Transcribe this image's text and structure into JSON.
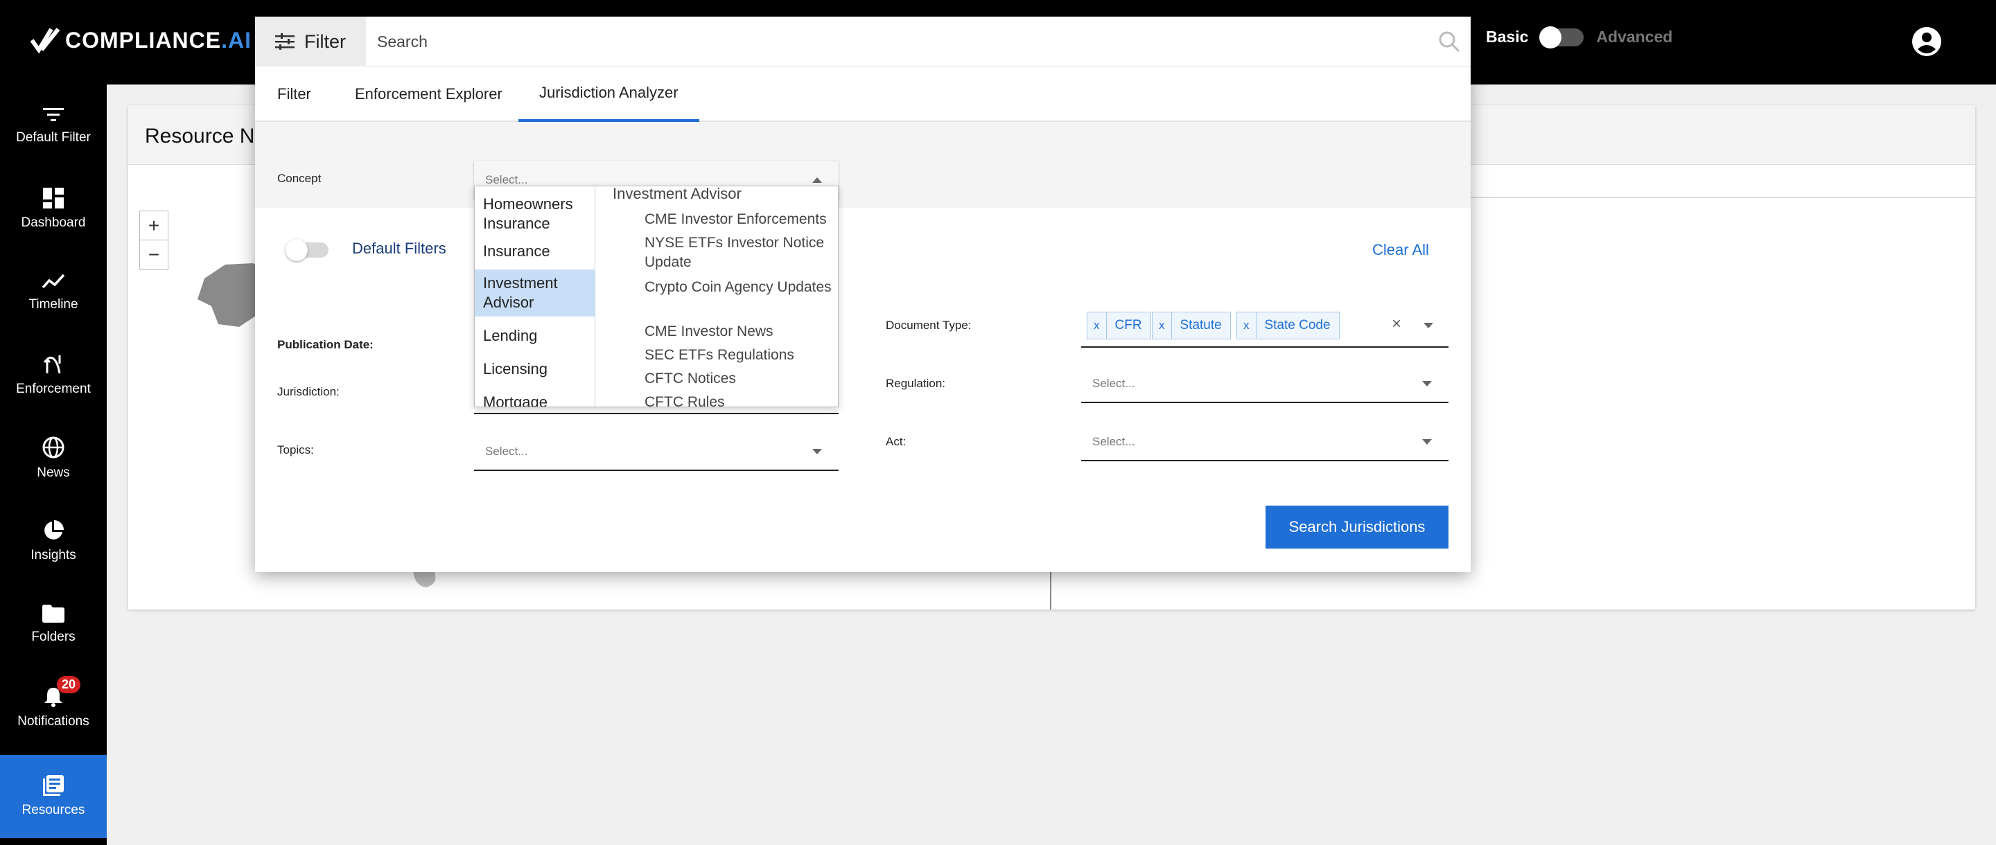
{
  "brand": {
    "name_main": "COMPLIANCE",
    "name_suffix": ".AI"
  },
  "header": {
    "mode_basic": "Basic",
    "mode_advanced": "Advanced"
  },
  "sidebar": {
    "items": [
      {
        "label": "Default Filter",
        "icon": "filter-lines-icon"
      },
      {
        "label": "Dashboard",
        "icon": "dashboard-icon"
      },
      {
        "label": "Timeline",
        "icon": "timeline-icon"
      },
      {
        "label": "Enforcement",
        "icon": "enforcement-icon"
      },
      {
        "label": "News",
        "icon": "globe-icon"
      },
      {
        "label": "Insights",
        "icon": "pie-chart-icon"
      },
      {
        "label": "Folders",
        "icon": "folder-icon"
      },
      {
        "label": "Notifications",
        "icon": "bell-icon",
        "badge": "20"
      },
      {
        "label": "Resources",
        "icon": "resources-icon",
        "active": true
      }
    ]
  },
  "background": {
    "card_title": "Resource Nav",
    "zoom_in": "+",
    "zoom_out": "−"
  },
  "modal": {
    "filter_button": "Filter",
    "search_placeholder": "Search",
    "tabs": [
      "Filter",
      "Enforcement Explorer",
      "Jurisdiction Analyzer"
    ],
    "active_tab": "Jurisdiction Analyzer",
    "concept_label": "Concept",
    "concept_placeholder": "Select...",
    "default_filters_label": "Default Filters",
    "clear_all": "Clear All",
    "publication_date_label": "Publication Date:",
    "jurisdiction_label": "Jurisdiction:",
    "topics_label": "Topics:",
    "topics_placeholder": "Select...",
    "document_type_label": "Document Type:",
    "document_type_chips": [
      "CFR",
      "Statute",
      "State Code"
    ],
    "chip_remove": "x",
    "chips_clear": "×",
    "regulation_label": "Regulation:",
    "regulation_placeholder": "Select...",
    "act_label": "Act:",
    "act_placeholder": "Select...",
    "search_button": "Search Jurisdictions"
  },
  "dropdown": {
    "categories": [
      "Homeowners Insurance",
      "Insurance",
      "Investment Advisor",
      "Lending",
      "Licensing",
      "Mortgage"
    ],
    "selected_category": "Investment Advisor",
    "group_heading": "Investment Advisor",
    "options": [
      "CME Investor Enforcements",
      "NYSE ETFs Investor Notice Update",
      "Crypto Coin Agency Updates",
      "CME Investor News",
      "SEC ETFs Regulations",
      "CFTC Notices",
      "CFTC Rules"
    ]
  },
  "colors": {
    "accent": "#1f6fd6",
    "topbar": "#000000",
    "badge": "#d42020"
  }
}
